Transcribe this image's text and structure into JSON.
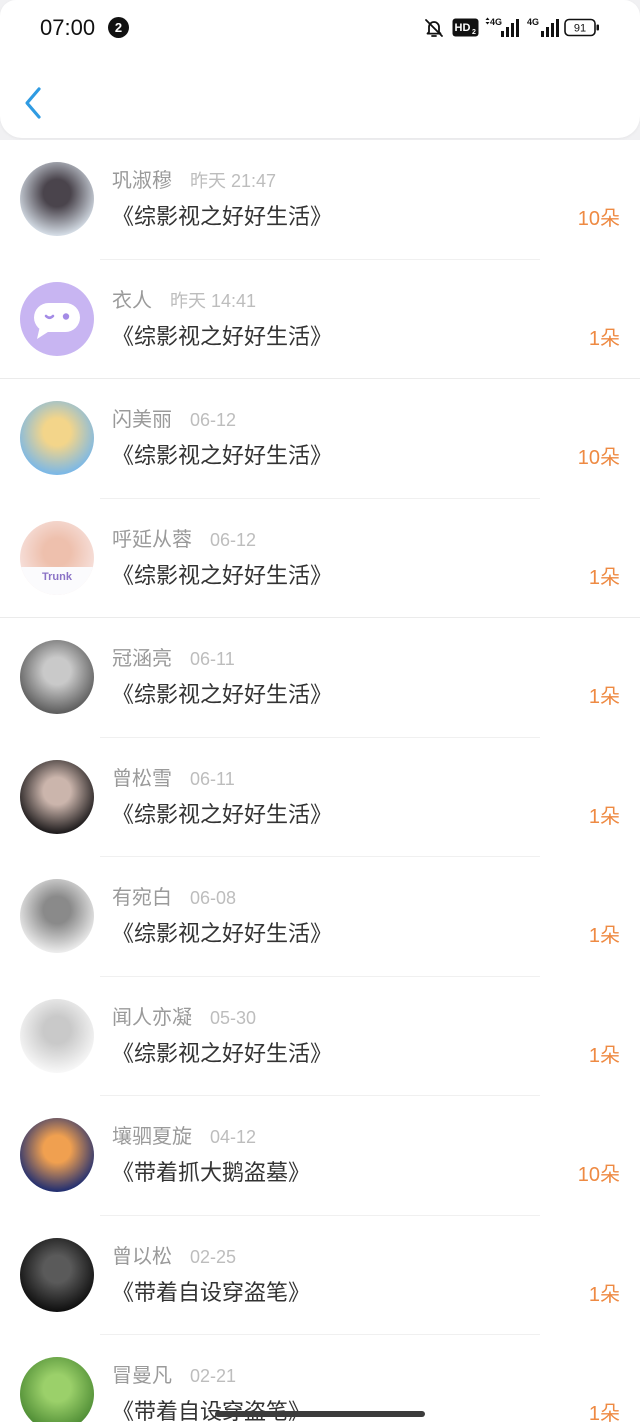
{
  "status_bar": {
    "time": "07:00",
    "notification_count": "2",
    "mute_icon": "bell-slash-icon",
    "hd_label": "HD",
    "hd_sub": "2",
    "signal_1_label": "4G",
    "signal_2_label": "4G",
    "signal_icon": "signal-bars-icon",
    "battery_icon": "battery-icon",
    "battery_level": "91"
  },
  "header": {
    "back_icon": "chevron-left-icon",
    "accent_color": "#2f9be2"
  },
  "list": {
    "count_color": "#ee8a43",
    "items": [
      {
        "name": "巩淑穆",
        "time": "昨天 21:47",
        "book": "《综影视之好好生活》",
        "count": "10朵",
        "avatar_colors": [
          "#4a444c",
          "#d3dbe4"
        ]
      },
      {
        "name": "衣人",
        "time": "昨天 14:41",
        "book": "《综影视之好好生活》",
        "count": "1朵",
        "avatar_colors": [
          "#c8b5f2"
        ],
        "avatar_icon": "chat-bubble-icon"
      },
      {
        "name": "闪美丽",
        "time": "06-12",
        "book": "《综影视之好好生活》",
        "count": "10朵",
        "avatar_colors": [
          "#f3d58a",
          "#7cb8e6"
        ]
      },
      {
        "name": "呼延从蓉",
        "time": "06-12",
        "book": "《综影视之好好生活》",
        "count": "1朵",
        "avatar_colors": [
          "#eec0ad",
          "#f7e2de"
        ],
        "avatar_text": "Trunk"
      },
      {
        "name": "冠涵亮",
        "time": "06-11",
        "book": "《综影视之好好生活》",
        "count": "1朵",
        "avatar_colors": [
          "#c9c9c9",
          "#5e5e5e"
        ]
      },
      {
        "name": "曾松雪",
        "time": "06-11",
        "book": "《综影视之好好生活》",
        "count": "1朵",
        "avatar_colors": [
          "#cbb5ac",
          "#1f1c1d"
        ]
      },
      {
        "name": "有宛白",
        "time": "06-08",
        "book": "《综影视之好好生活》",
        "count": "1朵",
        "avatar_colors": [
          "#8a8a8a",
          "#ebebeb"
        ]
      },
      {
        "name": "闻人亦凝",
        "time": "05-30",
        "book": "《综影视之好好生活》",
        "count": "1朵",
        "avatar_colors": [
          "#c9c9c9",
          "#f7f7f7"
        ]
      },
      {
        "name": "壤驷夏旋",
        "time": "04-12",
        "book": "《带着抓大鹅盗墓》",
        "count": "10朵",
        "avatar_colors": [
          "#f0a050",
          "#243070"
        ]
      },
      {
        "name": "曾以松",
        "time": "02-25",
        "book": "《带着自设穿盗笔》",
        "count": "1朵",
        "avatar_colors": [
          "#5a5a5a",
          "#101010"
        ]
      },
      {
        "name": "冒曼凡",
        "time": "02-21",
        "book": "《带着自设穿盗笔》",
        "count": "1朵",
        "avatar_colors": [
          "#9bd06a",
          "#4f8d35"
        ]
      }
    ]
  }
}
